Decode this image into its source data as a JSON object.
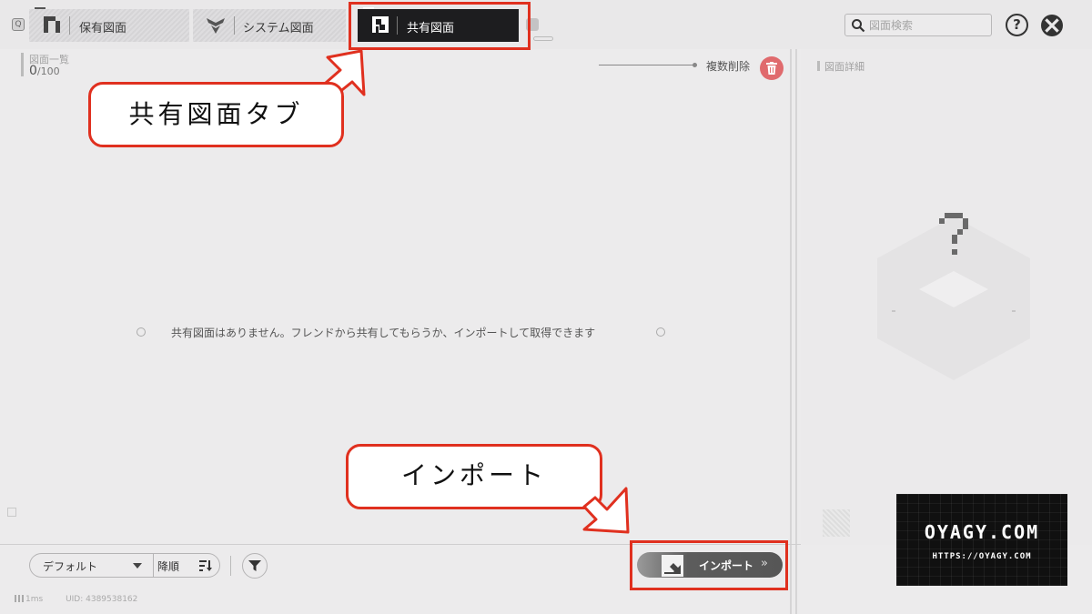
{
  "top_bar": {
    "tabs": [
      {
        "label": "保有図面",
        "active": false
      },
      {
        "label": "システム図面",
        "active": false
      },
      {
        "label": "共有図面",
        "active": true
      }
    ],
    "search_placeholder": "図面検索",
    "help_label": "?"
  },
  "list_panel": {
    "title": "図面一覧",
    "count": "0",
    "max": "/100",
    "multi_delete_label": "複数削除",
    "empty_message": "共有図面はありません。フレンドから共有してもらうか、インポートして取得できます"
  },
  "detail_panel": {
    "title": "図面詳細"
  },
  "bottom_bar": {
    "sort_value": "デフォルト",
    "order_label": "降順",
    "import_label": "インポート",
    "status_ping": "1ms",
    "status_uid": "UID: 4389538162"
  },
  "annotations": {
    "tab_callout": "共有図面タブ",
    "import_callout": "インポート"
  },
  "watermark": {
    "title": "OYAGY.COM",
    "url": "HTTPS://OYAGY.COM"
  },
  "colors": {
    "highlight": "#e0301f",
    "active_tab": "#1d1d1f",
    "delete_button": "#e06a6d",
    "background": "#ecebec"
  }
}
